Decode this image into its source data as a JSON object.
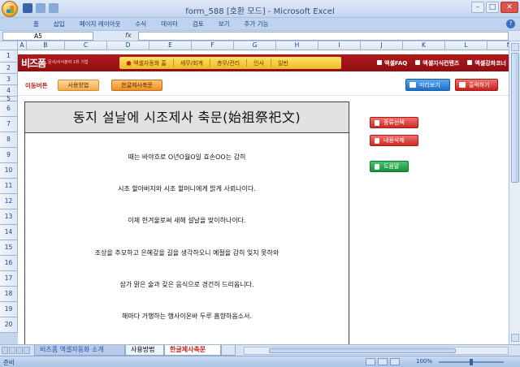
{
  "window": {
    "title": "form_588  [호환 모드] - Microsoft Excel"
  },
  "ribbon": {
    "tabs": [
      "홈",
      "삽입",
      "페이지 레이아웃",
      "수식",
      "데이터",
      "검토",
      "보기",
      "추가 기능"
    ]
  },
  "formula_bar": {
    "name_box": "A5",
    "fx_label": "fx",
    "value": ""
  },
  "columns": [
    "A",
    "B",
    "C",
    "D",
    "E",
    "F",
    "G",
    "H",
    "I",
    "J",
    "K",
    "L",
    "M"
  ],
  "rows": [
    "1",
    "2",
    "3",
    "4",
    "5",
    "6",
    "7",
    "8",
    "9",
    "10",
    "11",
    "12",
    "13",
    "14",
    "15",
    "16",
    "17",
    "18",
    "19",
    "20",
    "21"
  ],
  "nav": {
    "logo": "비즈폼",
    "logo_sub": "문서/서식분야 1위 기업",
    "menu": [
      "엑셀자동화 홈",
      "세무/회계",
      "총무/관리",
      "인사",
      "일반"
    ],
    "right_links": [
      "엑셀FAQ",
      "엑셀지식컨텐츠",
      "엑셀강좌코너"
    ]
  },
  "toolbar": {
    "move_label": "이동버튼",
    "usage_button": "사용방법",
    "korean_button": "한글제사축문",
    "preview_button": "미리보기",
    "print_button": "출력하기"
  },
  "document": {
    "title": "동지 설날에 시조제사 축문(始祖祭祀文)",
    "lines": [
      "때는 바야흐로 O년O월O일 효손OO는 감히",
      "시조 할아버지와 시조 할머니에게 밝게 사뢰나이다.",
      "이제 한겨울로써 새해 설날을 맞이하나이다.",
      "조상을 추모하고  은혜갚을 길을 생각하오니 예절을 감히 잊지 못하와",
      "삼가 맑은 술과 갖은 음식으로 경건히 드리옵니다.",
      "해마다 거행하는 행사이온바 두루 흠향하옵소서."
    ]
  },
  "side_buttons": {
    "select_type": "종류선택",
    "delete_content": "내용삭제",
    "help": "도움말"
  },
  "sheet_tabs": [
    "비즈폼 엑셀자동화 소개",
    "사용방법",
    "한글제사축문"
  ],
  "status": {
    "ready": "준비",
    "zoom": "100%"
  },
  "colors": {
    "nav_red": "#a11418",
    "menu_yellow": "#f6c53a",
    "accent_orange": "#ec8f23",
    "preview_blue": "#1e6fc8",
    "print_red": "#c6221c",
    "help_green": "#17913b"
  }
}
